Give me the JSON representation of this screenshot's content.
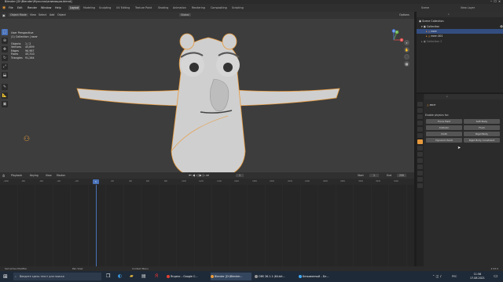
{
  "window": {
    "title": "Blender [D:\\Blender\\Мультик\\анимация.blend]"
  },
  "menu": {
    "items": [
      "File",
      "Edit",
      "Render",
      "Window",
      "Help"
    ]
  },
  "workspaces": {
    "tabs": [
      "Layout",
      "Modeling",
      "Sculpting",
      "UV Editing",
      "Texture Paint",
      "Shading",
      "Animation",
      "Rendering",
      "Compositing",
      "Scripting"
    ],
    "active": "Layout",
    "scene_label": "Scene",
    "view_layer_label": "View Layer"
  },
  "viewport": {
    "mode": "Object Mode",
    "menu": [
      "View",
      "Select",
      "Add",
      "Object"
    ],
    "orientation": "Global",
    "options_label": "Options",
    "view_name": "User Perspective",
    "collection_info": "(1) Collection | мозг",
    "stats": [
      {
        "label": "Objects",
        "value": "1 / 2"
      },
      {
        "label": "Vertices",
        "value": "45,899"
      },
      {
        "label": "Edges",
        "value": "90,987"
      },
      {
        "label": "Faces",
        "value": "45,310"
      },
      {
        "label": "Triangles",
        "value": "91,264"
      }
    ],
    "gizmo": {
      "x": "X",
      "y": "Y",
      "z": "Z"
    }
  },
  "timeline": {
    "menu": [
      "Playback",
      "Keying",
      "View",
      "Marker"
    ],
    "current_frame": "1",
    "start_label": "Start",
    "start": "1",
    "end_label": "End",
    "end": "250",
    "ticks": [
      "-100",
      "-80",
      "-60",
      "-40",
      "-20",
      "0",
      "20",
      "40",
      "60",
      "80",
      "100",
      "120",
      "140",
      "160",
      "180",
      "200",
      "220",
      "240",
      "260",
      "280",
      "300",
      "320",
      "340",
      "360",
      "380"
    ]
  },
  "outliner": {
    "root": "Scene Collection",
    "rows": [
      {
        "name": "Collection"
      },
      {
        "name": "мозг"
      },
      {
        "name": "мозг.001"
      },
      {
        "name": "Collection 2"
      }
    ]
  },
  "properties": {
    "object_name": "мозг",
    "section": "Enable physics for:",
    "buttons": [
      "Force Field",
      "Soft Body",
      "Collision",
      "Fluid",
      "Cloth",
      "Rigid Body",
      "Dynamic Paint",
      "Rigid Body Constraint"
    ]
  },
  "statusbar": {
    "left": "Set Active Modifier",
    "mid1": "Pan View",
    "mid2": "Context Menu",
    "right": "2.93.0"
  },
  "taskbar": {
    "search_placeholder": "Введите здесь текст для поиска",
    "apps": [
      "Яндекс – Google C...",
      "Blender [D:\\Blender...",
      "OBS 26.1.1 (64-bit...",
      "Безымянный – Бл..."
    ],
    "time": "11:56",
    "date": "17.08.2021",
    "lang": "РУС"
  },
  "colors": {
    "accent": "#4a72b8",
    "orange": "#e89a3c",
    "physics_button": "#555555"
  }
}
